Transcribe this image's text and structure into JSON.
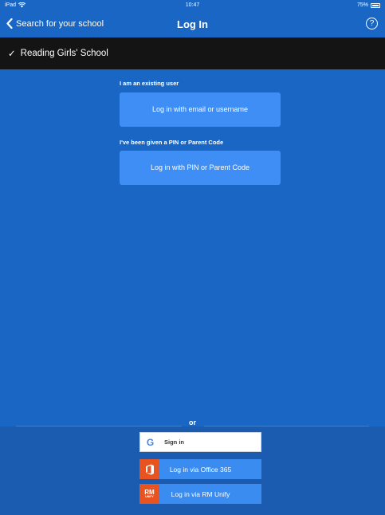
{
  "status_bar": {
    "device": "iPad",
    "time": "10:47",
    "battery": "75%",
    "battery_level": 0.75
  },
  "nav": {
    "back_label": "Search for your school",
    "title": "Log In",
    "help_symbol": "?"
  },
  "school": {
    "name": "Reading Girls' School",
    "check_symbol": "✓"
  },
  "existing_user": {
    "label": "I am an existing user",
    "button": "Log in with email or username"
  },
  "pin_user": {
    "label": "I've been given a PIN or Parent Code",
    "button": "Log in with PIN or Parent Code"
  },
  "or_label": "or",
  "alt_logins": {
    "google": {
      "label": "Sign in",
      "icon": "G"
    },
    "office": {
      "label": "Log in via Office 365"
    },
    "rm": {
      "label": "Log in via RM Unify",
      "icon_top": "RM",
      "icon_bottom": "UNIFY"
    }
  },
  "colors": {
    "primary_blue": "#1a66c4",
    "button_blue": "#3f8ef5",
    "school_bar": "#141414",
    "office_orange": "#e9531f"
  }
}
